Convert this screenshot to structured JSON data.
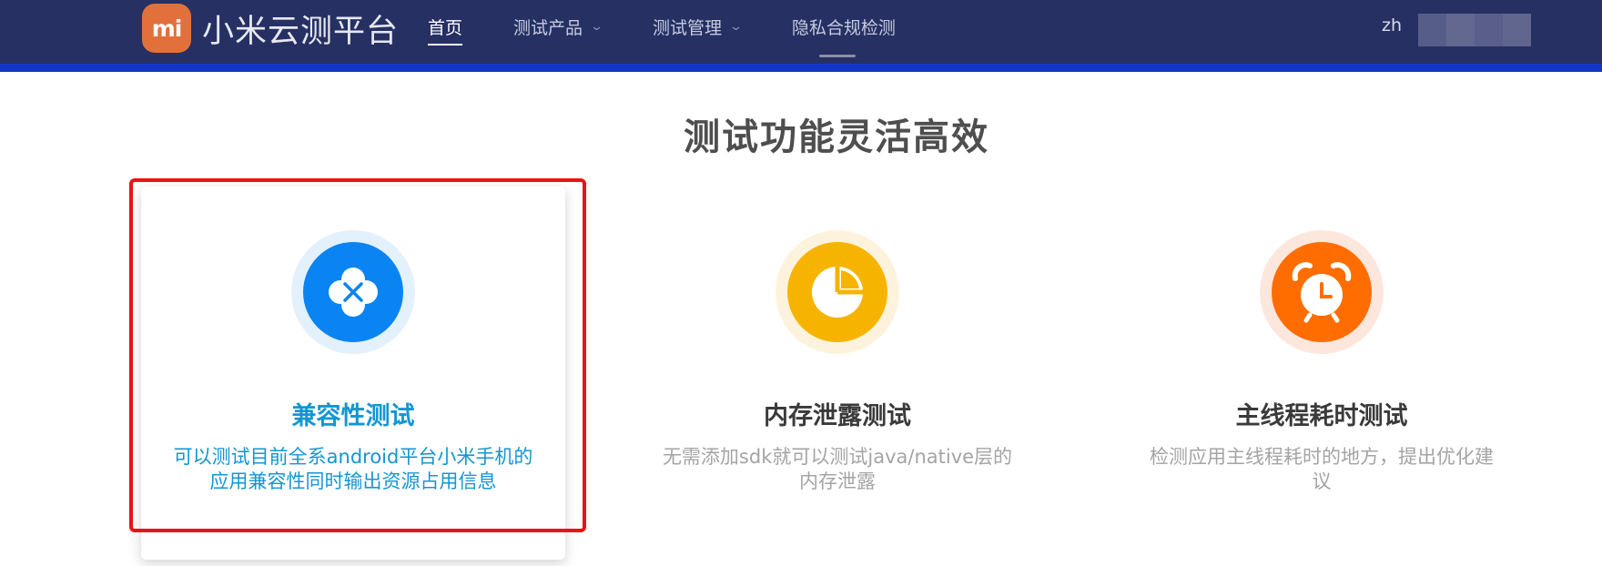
{
  "header": {
    "logo_text": "mi",
    "brand_name": "小米云测平台",
    "nav": [
      {
        "label": "首页",
        "active": true,
        "has_dropdown": false
      },
      {
        "label": "测试产品",
        "active": false,
        "has_dropdown": true
      },
      {
        "label": "测试管理",
        "active": false,
        "has_dropdown": true
      },
      {
        "label": "隐私合规检测",
        "active": false,
        "has_dropdown": false
      }
    ],
    "language": "zh"
  },
  "section": {
    "title": "测试功能灵活高效",
    "features": [
      {
        "title": "兼容性测试",
        "description": "可以测试目前全系android平台小米手机的应用兼容性同时输出资源占用信息",
        "icon": "compatibility-icon",
        "color": "#0a84f2",
        "ring_color": "#e3f1fd",
        "highlighted": true
      },
      {
        "title": "内存泄露测试",
        "description": "无需添加sdk就可以测试java/native层的内存泄露",
        "icon": "pie-chart-icon",
        "color": "#f6b400",
        "ring_color": "#fdf3dc",
        "highlighted": false
      },
      {
        "title": "主线程耗时测试",
        "description": "检测应用主线程耗时的地方，提出优化建议",
        "icon": "alarm-clock-icon",
        "color": "#ff6d00",
        "ring_color": "#fde7dc",
        "highlighted": false
      }
    ]
  }
}
